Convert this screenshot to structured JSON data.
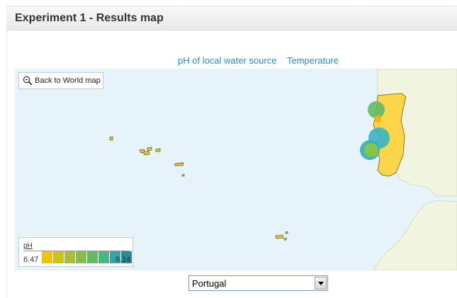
{
  "header": {
    "title": "Experiment 1 - Results map"
  },
  "map_links": [
    {
      "label": "pH of local water source",
      "active": true
    },
    {
      "label": "Temperature",
      "active": false
    }
  ],
  "map": {
    "back_button": {
      "label": "Back to World map",
      "icon": "zoom-out-icon"
    },
    "water_color": "#e6f3fb",
    "land_color": "#f1f5df",
    "highlight_color": "#fbd64a",
    "markers": [
      {
        "color": "#66bb66"
      },
      {
        "color": "#f7b300"
      },
      {
        "color": "#3cb6c2"
      },
      {
        "color": "#35aeba"
      },
      {
        "color": "#8cc63f"
      }
    ],
    "legend": {
      "title": "pH",
      "min": "6.47",
      "max": "8.14",
      "colors": [
        "#f2c400",
        "#c9c31a",
        "#a8c030",
        "#86bd48",
        "#62ba62",
        "#45b78a",
        "#2ea8a6",
        "#238e96"
      ]
    }
  },
  "region_select": {
    "value": "Portugal"
  }
}
